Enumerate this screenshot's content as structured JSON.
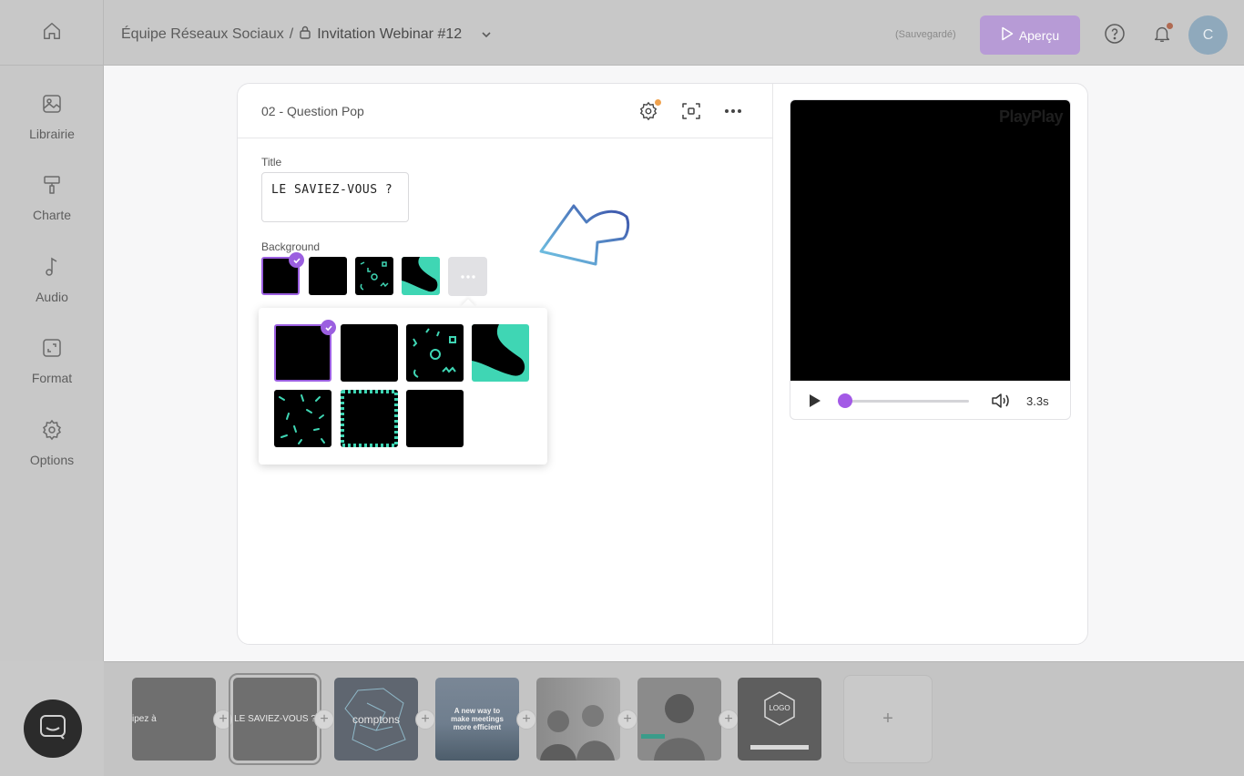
{
  "topbar": {
    "team": "Équipe Réseaux Sociaux",
    "separator": "/",
    "project_title": "Invitation Webinar #12",
    "saved_status": "(Sauvegardé)",
    "preview_label": "Aperçu",
    "avatar_initial": "C"
  },
  "sidebar": {
    "items": [
      {
        "label": "Librairie",
        "icon": "image-icon"
      },
      {
        "label": "Charte",
        "icon": "paint-roller-icon"
      },
      {
        "label": "Audio",
        "icon": "music-note-icon"
      },
      {
        "label": "Format",
        "icon": "resize-icon"
      },
      {
        "label": "Options",
        "icon": "gear-icon"
      }
    ]
  },
  "scene": {
    "name": "02 - Question Pop",
    "title_label": "Title",
    "title_value": "LE SAVIEZ-VOUS ?",
    "background_label": "Background",
    "more_label": "..."
  },
  "video": {
    "watermark": "PlayPlay",
    "time": "3.3s",
    "progress": 0.0
  },
  "timeline": {
    "slides": [
      {
        "text": "ipez à"
      },
      {
        "text": "LE SAVIEZ-VOUS ?"
      },
      {
        "text": "comptons"
      },
      {
        "text": "A new way to make meetings more efficient"
      },
      {
        "text": ""
      },
      {
        "text": ""
      },
      {
        "text": "LOGO"
      }
    ],
    "add_label": "+"
  },
  "colors": {
    "accent": "#9b5fe0",
    "teal": "#3fd6b4",
    "preview_button": "#b79bd6"
  }
}
